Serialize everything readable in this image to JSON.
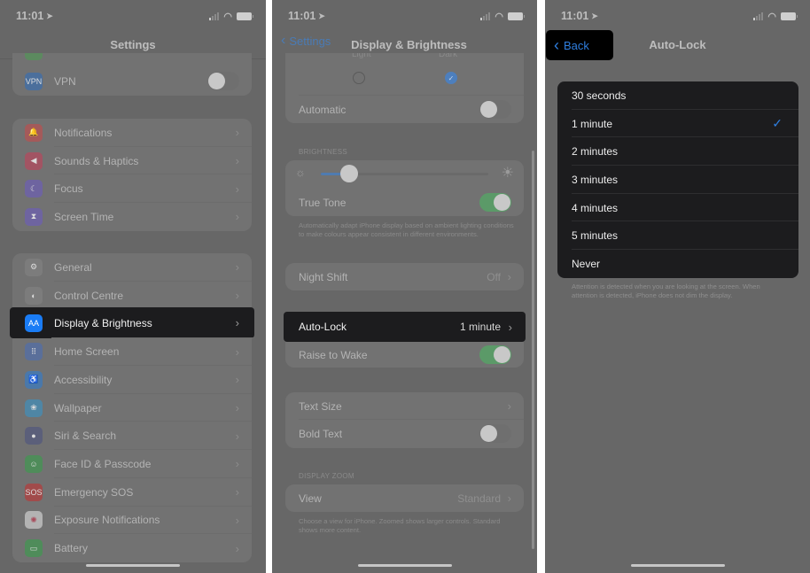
{
  "status_bar": {
    "time": "11:01",
    "location_icon": "location-arrow-icon",
    "signal_icon": "cellular-signal-icon",
    "wifi_icon": "wifi-icon",
    "battery_icon": "battery-icon"
  },
  "panel1": {
    "title": "Settings",
    "group0": [
      {
        "label": "VPN",
        "icon": "vpn-icon",
        "icon_text": "VPN",
        "color": "#4b6f9c",
        "toggle": false
      }
    ],
    "group1": [
      {
        "label": "Notifications",
        "icon": "bell-icon",
        "color": "#a45a5a"
      },
      {
        "label": "Sounds & Haptics",
        "icon": "speaker-icon",
        "color": "#a25463"
      },
      {
        "label": "Focus",
        "icon": "moon-icon",
        "color": "#6e64a0"
      },
      {
        "label": "Screen Time",
        "icon": "hourglass-icon",
        "color": "#6e64a0"
      }
    ],
    "group2": [
      {
        "label": "General",
        "icon": "gear-icon",
        "color": "#7c7c7c"
      },
      {
        "label": "Control Centre",
        "icon": "switches-icon",
        "color": "#7c7c7c"
      },
      {
        "label": "Display & Brightness",
        "icon": "text-size-icon",
        "icon_text": "AA",
        "color": "#1a7cf5",
        "highlighted": true
      },
      {
        "label": "Home Screen",
        "icon": "app-grid-icon",
        "color": "#5a6f9a"
      },
      {
        "label": "Accessibility",
        "icon": "accessibility-icon",
        "color": "#4a78aa"
      },
      {
        "label": "Wallpaper",
        "icon": "flower-icon",
        "color": "#4f86a5"
      },
      {
        "label": "Siri & Search",
        "icon": "siri-icon",
        "color": "#5b5f7a"
      },
      {
        "label": "Face ID & Passcode",
        "icon": "face-id-icon",
        "color": "#4f8c5a"
      },
      {
        "label": "Emergency SOS",
        "icon": "sos-icon",
        "icon_text": "SOS",
        "color": "#a14b4b"
      },
      {
        "label": "Exposure Notifications",
        "icon": "exposure-icon",
        "color": "#b3b3b3"
      },
      {
        "label": "Battery",
        "icon": "battery-app-icon",
        "color": "#4f8c5a"
      }
    ]
  },
  "panel2": {
    "back_label": "Settings",
    "title": "Display & Brightness",
    "appearance": {
      "light_label": "Light",
      "dark_label": "Dark",
      "selected": "Dark"
    },
    "automatic_label": "Automatic",
    "automatic_on": false,
    "brightness_header": "BRIGHTNESS",
    "brightness_level": 0.17,
    "true_tone_label": "True Tone",
    "true_tone_on": true,
    "true_tone_footer": "Automatically adapt iPhone display based on ambient lighting conditions to make colours appear consistent in different environments.",
    "night_shift_label": "Night Shift",
    "night_shift_value": "Off",
    "auto_lock_label": "Auto-Lock",
    "auto_lock_value": "1 minute",
    "raise_to_wake_label": "Raise to Wake",
    "raise_to_wake_on": true,
    "text_size_label": "Text Size",
    "bold_text_label": "Bold Text",
    "bold_text_on": false,
    "display_zoom_header": "DISPLAY ZOOM",
    "view_label": "View",
    "view_value": "Standard",
    "view_footer": "Choose a view for iPhone. Zoomed shows larger controls. Standard shows more content."
  },
  "panel3": {
    "back_label": "Back",
    "title": "Auto-Lock",
    "options": [
      "30 seconds",
      "1 minute",
      "2 minutes",
      "3 minutes",
      "4 minutes",
      "5 minutes",
      "Never"
    ],
    "selected": "1 minute",
    "footer": "Attention is detected when you are looking at the screen. When attention is detected, iPhone does not dim the display.",
    "accent": "#2f7fe0"
  }
}
